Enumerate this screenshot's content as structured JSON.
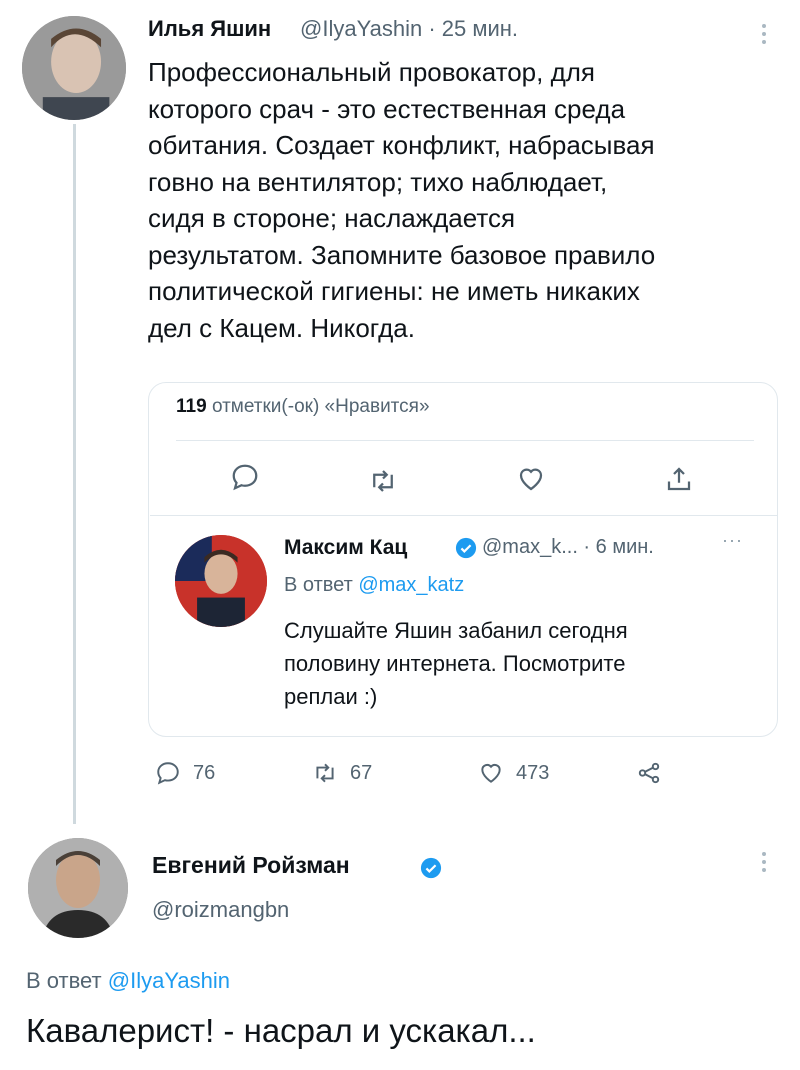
{
  "tweet1": {
    "author_name": "Илья Яшин",
    "handle_time": "@IlyaYashin · 25 мин.",
    "text": "Профессиональный провокатор, для\nкоторого срач - это естественная среда\nобитания. Создает конфликт, набрасывая\nговно на вентилятор; тихо наблюдает,\nсидя в стороне; наслаждается\nрезультатом. Запомните базовое правило\nполитической гигиены: не иметь никаких\nдел с Кацем. Никогда.",
    "likes_count": "119",
    "likes_label": "отметки(-ок) «Нравится»",
    "avatar_icon": "user-photo-icon"
  },
  "quoted_tweet": {
    "author_name": "Максим Кац",
    "handle_time": "@max_k... · 6 мин.",
    "more": "···",
    "reply_prefix": "В ответ",
    "reply_mention": "@max_katz",
    "text": "Слушайте Яшин забанил сегодня\nполовину интернета. Посмотрите\nреплаи :)",
    "stats": {
      "replies": "76",
      "retweets": "67",
      "likes": "473"
    }
  },
  "tweet2": {
    "author_name": "Евгений Ройзман",
    "handle": "@roizmangbn",
    "reply_prefix": "В ответ",
    "reply_mention": "@IlyaYashin",
    "text": "Кавалерист! - насрал и ускакал..."
  },
  "colors": {
    "accent": "#1d9bf0",
    "text": "#0f1419",
    "muted": "#536471",
    "border": "#e1e8ed"
  }
}
